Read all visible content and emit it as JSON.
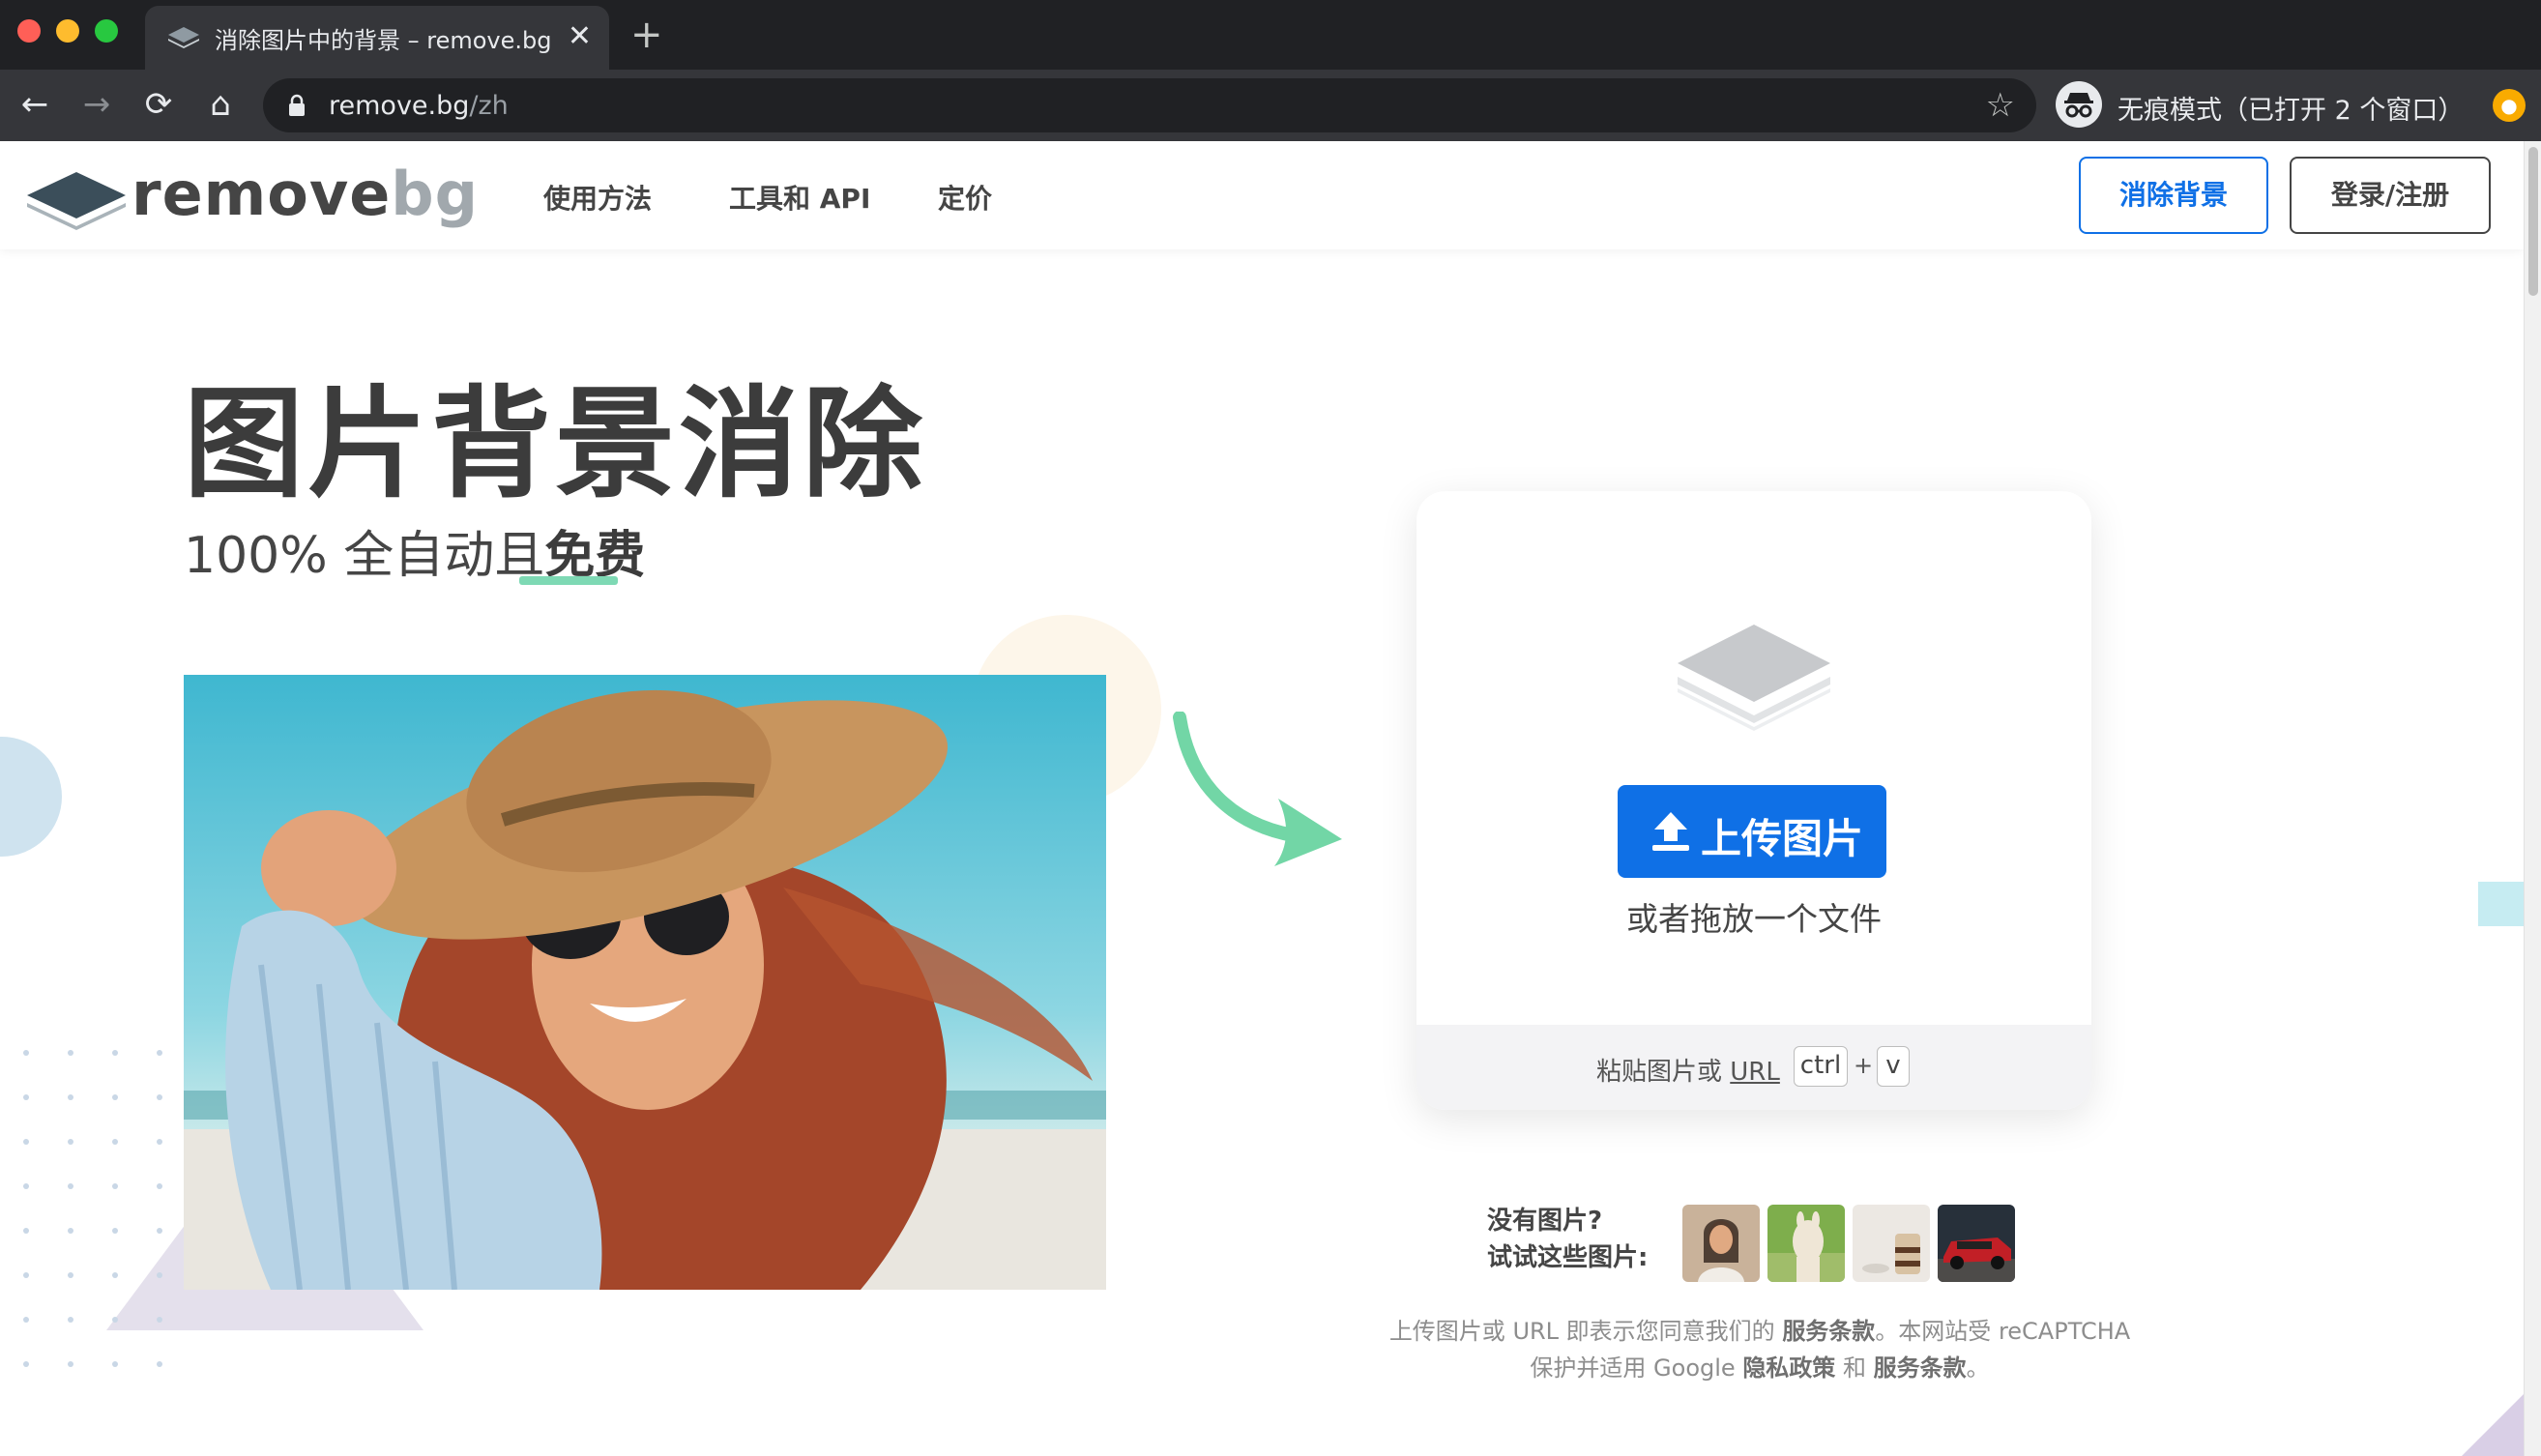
{
  "browser": {
    "tab_title": "消除图片中的背景 – remove.bg",
    "new_tab_symbol": "+",
    "url_host": "remove.bg",
    "url_path": "/zh",
    "incognito_text": "无痕模式（已打开 2 个窗口）",
    "colors": {
      "titlebar": "#202124",
      "toolbar": "#35363a",
      "close": "#ff5f57",
      "minimize": "#febc2e",
      "zoom": "#28c840"
    }
  },
  "header": {
    "logo_main": "remove",
    "logo_accent": "bg",
    "nav": [
      "使用方法",
      "工具和 API",
      "定价"
    ],
    "remove_bg_button": "消除背景",
    "login_button": "登录/注册"
  },
  "hero": {
    "title": "图片背景消除",
    "subtitle_prefix": "100% 全自动且",
    "subtitle_highlight": "免费"
  },
  "upload": {
    "button_label": "上传图片",
    "drop_text": "或者拖放一个文件",
    "paste_prefix": "粘贴图片或 ",
    "paste_url": "URL",
    "key_ctrl": "ctrl",
    "key_plus": "+",
    "key_v": "v",
    "accent_color": "#0f70e6"
  },
  "samples": {
    "line1": "没有图片?",
    "line2": "试试这些图片:",
    "thumbs": [
      "sample-woman",
      "sample-alpaca",
      "sample-cake",
      "sample-car"
    ]
  },
  "footer_note": {
    "text1": "上传图片或 URL 即表示您同意我们的 ",
    "terms1": "服务条款",
    "text2": "。本网站受 reCAPTCHA 保护并适用 Google ",
    "privacy": "隐私政策",
    "text3": " 和 ",
    "terms2": "服务条款",
    "text4": "。"
  }
}
